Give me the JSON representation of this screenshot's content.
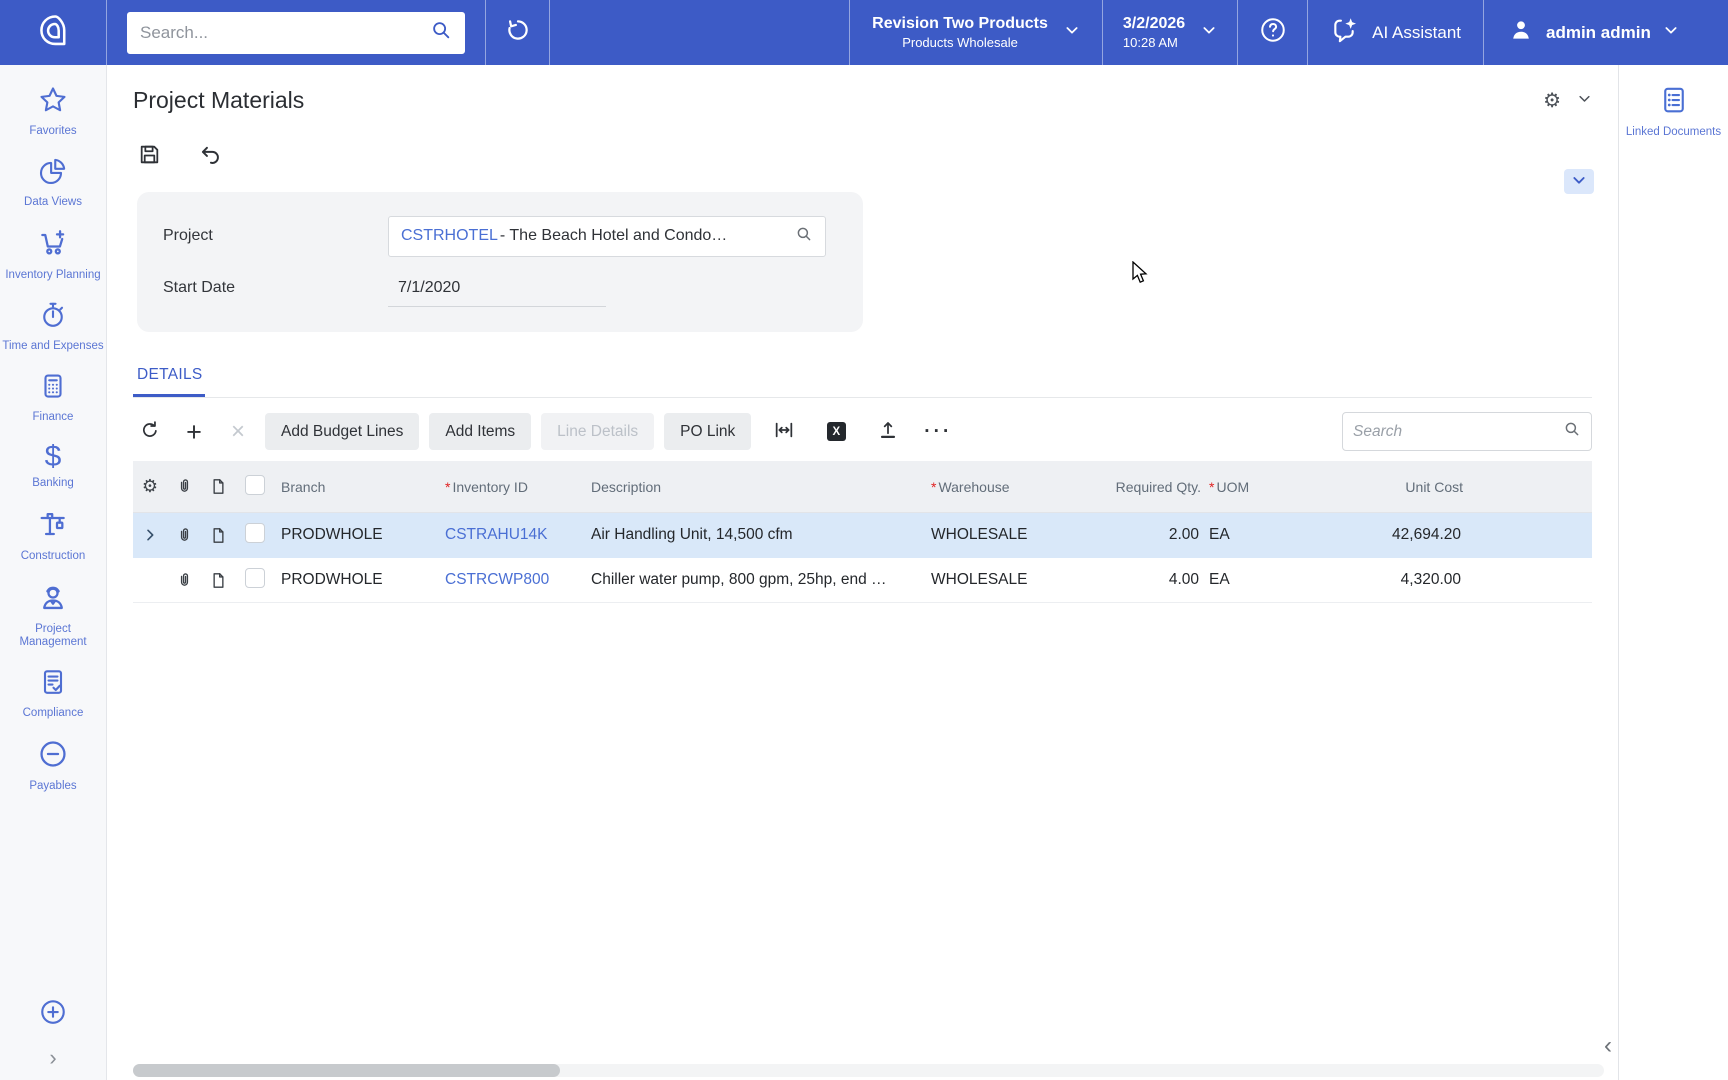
{
  "topbar": {
    "search_placeholder": "Search...",
    "company": {
      "name": "Revision Two Products",
      "branch": "Products Wholesale"
    },
    "datetime": {
      "date": "3/2/2026",
      "time": "10:28 AM"
    },
    "ai_label": "AI Assistant",
    "user_name": "admin admin"
  },
  "sidebar": {
    "items": [
      {
        "icon": "star-icon",
        "label": "Favorites"
      },
      {
        "icon": "pie-chart-icon",
        "label": "Data Views"
      },
      {
        "icon": "cart-plus-icon",
        "label": "Inventory Planning"
      },
      {
        "icon": "stopwatch-icon",
        "label": "Time and Expenses"
      },
      {
        "icon": "calculator-icon",
        "label": "Finance"
      },
      {
        "icon": "dollar-icon",
        "label": "Banking"
      },
      {
        "icon": "crane-icon",
        "label": "Construction"
      },
      {
        "icon": "worker-icon",
        "label": "Project Management"
      },
      {
        "icon": "clipboard-check-icon",
        "label": "Compliance"
      },
      {
        "icon": "minus-circle-icon",
        "label": "Payables"
      }
    ]
  },
  "page": {
    "title": "Project Materials",
    "form": {
      "project_label": "Project",
      "project_id": "CSTRHOTEL",
      "project_rest": " - The Beach Hotel and Condo…",
      "start_date_label": "Start Date",
      "start_date_value": "7/1/2020"
    },
    "tab_label": "DETAILS",
    "toolbar": {
      "buttons": [
        {
          "label": "Add Budget Lines",
          "enabled": true
        },
        {
          "label": "Add Items",
          "enabled": true
        },
        {
          "label": "Line Details",
          "enabled": false
        },
        {
          "label": "PO Link",
          "enabled": true
        }
      ],
      "search_placeholder": "Search"
    },
    "grid": {
      "required_marker": "*",
      "columns": {
        "branch": "Branch",
        "inventory_id": "Inventory ID",
        "description": "Description",
        "warehouse": "Warehouse",
        "required_qty": "Required Qty.",
        "uom": "UOM",
        "unit_cost": "Unit Cost"
      },
      "rows": [
        {
          "branch": "PRODWHOLE",
          "inventory_id": "CSTRAHU14K",
          "description": "Air Handling Unit, 14,500 cfm",
          "warehouse": "WHOLESALE",
          "required_qty": "2.00",
          "uom": "EA",
          "unit_cost": "42,694.20",
          "selected": true
        },
        {
          "branch": "PRODWHOLE",
          "inventory_id": "CSTRCWP800",
          "description": "Chiller water pump, 800 gpm, 25hp, end …",
          "warehouse": "WHOLESALE",
          "required_qty": "4.00",
          "uom": "EA",
          "unit_cost": "4,320.00",
          "selected": false
        }
      ]
    }
  },
  "right_panel": {
    "linked_documents_label": "Linked Documents"
  },
  "glyphs": {
    "gear": "⚙",
    "plus": "+",
    "delete": "×",
    "more": "···",
    "excel": "X",
    "sidebar_expand": "›",
    "panel_collapse": "‹"
  },
  "colors": {
    "topbar_blue": "#3d5bc6",
    "accent_blue": "#3d5cc7",
    "link_blue": "#4a6fd4",
    "selected_row": "#d9e8f9",
    "grid_header_bg": "#eef0f3",
    "required_red": "#e02222",
    "sidebar_label": "#5b76d4"
  }
}
